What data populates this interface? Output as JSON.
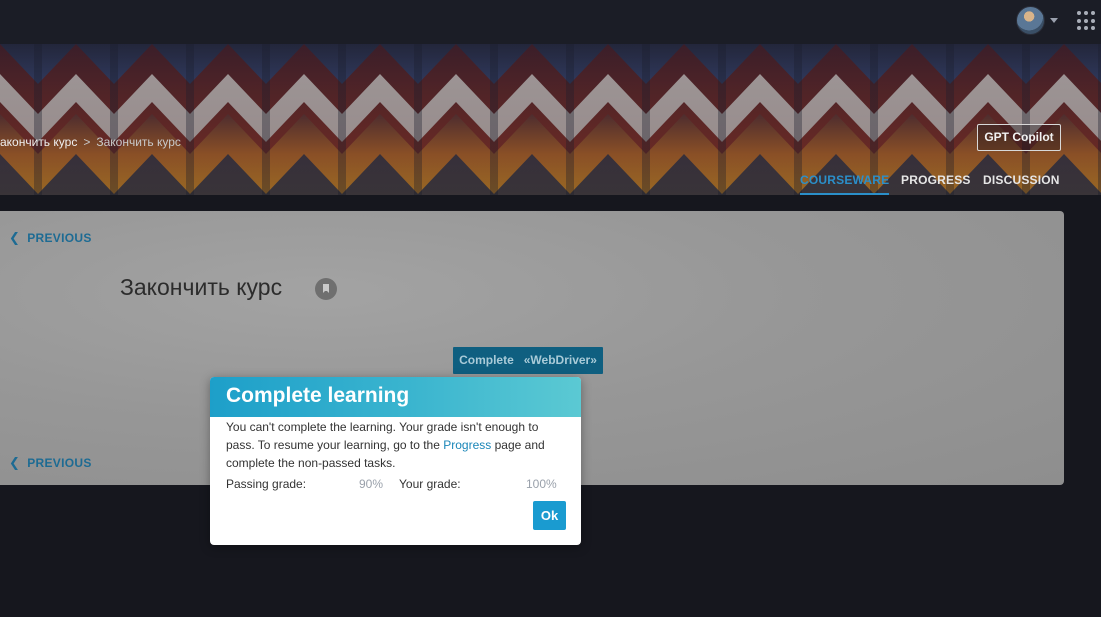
{
  "header": {
    "avatar_icon": "user-avatar",
    "apps_icon": "apps-grid-icon"
  },
  "breadcrumb": {
    "parent": "акончить курс",
    "separator": ">",
    "current": "Закончить курс"
  },
  "course_nav": {
    "gpt_button": "GPT Copilot",
    "tabs": [
      {
        "label": "COURSEWARE",
        "active": true
      },
      {
        "label": "PROGRESS",
        "active": false
      },
      {
        "label": "DISCUSSION",
        "active": false
      }
    ]
  },
  "unit": {
    "previous_top": "PREVIOUS",
    "previous_bottom": "PREVIOUS",
    "title": "Закончить курс",
    "bookmark_icon": "bookmark-icon",
    "complete_button": "Complete   «WebDriver»"
  },
  "modal": {
    "title": "Complete learning",
    "message_before_link": "You can't complete the learning. Your grade isn't enough to pass. To resume your learning, go to the ",
    "message_link": "Progress",
    "message_after_link": " page and complete the non-passed tasks.",
    "passing_grade_label": "Passing grade:",
    "passing_grade_value": "90%",
    "your_grade_label": "Your grade:",
    "your_grade_value": "100%",
    "ok_button": "Ok"
  },
  "colors": {
    "accent": "#1a9bd0",
    "link": "#1a86b8",
    "active_tab": "#2b8fc9",
    "topbar": "#1b1d26"
  }
}
